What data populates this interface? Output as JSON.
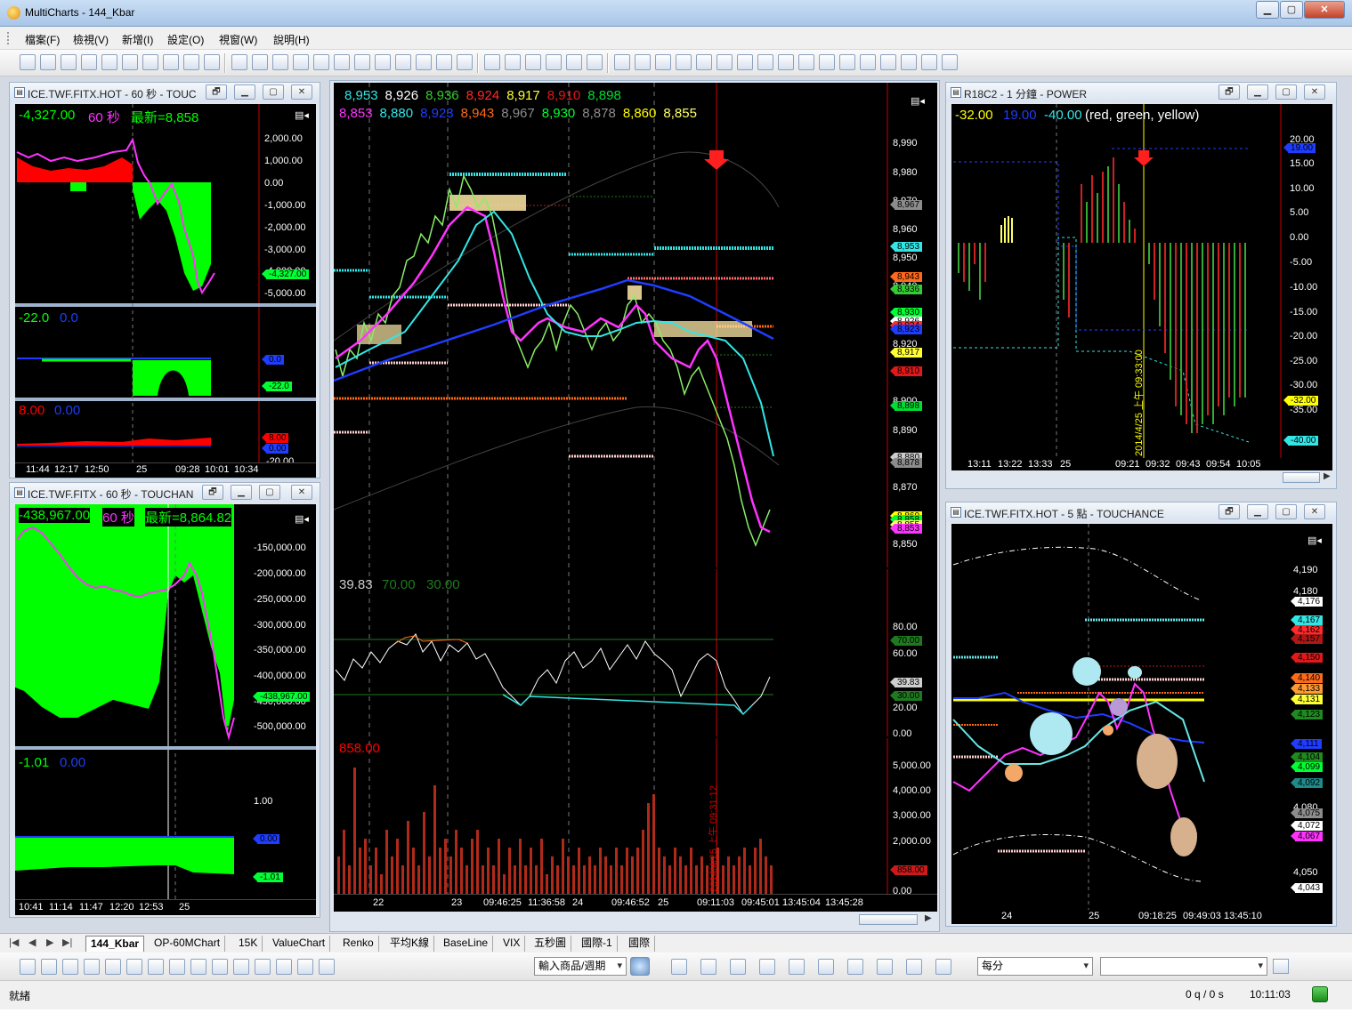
{
  "window": {
    "title": "MultiCharts - 144_Kbar"
  },
  "menu": [
    "檔案(F)",
    "檢視(V)",
    "新增(I)",
    "設定(O)",
    "視窗(W)",
    "說明(H)"
  ],
  "panes": {
    "left_top": {
      "title": "ICE.TWF.FITX.HOT - 60 秒 - TOUC",
      "status1": "-4,327.00",
      "status2": "60 秒",
      "status3": "最新=8,858",
      "yaxis": [
        "2,000.00",
        "1,000.00",
        "0.00",
        "-1,000.00",
        "-2,000.00",
        "-3,000.00",
        "-4,000.00",
        "-5,000.00"
      ],
      "tag_main": "-4,327.00",
      "sub1_status": [
        "-22.0",
        "0.0"
      ],
      "sub1_tags": [
        "0.0",
        "-22.0"
      ],
      "sub2_status": [
        "8.00",
        "0.00"
      ],
      "sub2_tags": [
        "8.00",
        "0.00"
      ],
      "sub2_axis_cut": "-20.00",
      "xaxis": [
        "11:44",
        "12:17",
        "12:50",
        "25",
        "09:28",
        "10:01",
        "10:34"
      ]
    },
    "left_bottom": {
      "title": "ICE.TWF.FITX - 60 秒 - TOUCHAN",
      "status1": "-438,967.00",
      "status2": "60 秒",
      "status3": "最新=8,864.82",
      "yaxis": [
        "-150,000.00",
        "-200,000.00",
        "-250,000.00",
        "-300,000.00",
        "-350,000.00",
        "-400,000.00",
        "-450,000.00",
        "-500,000.00"
      ],
      "tag_main": "-438,967.00",
      "sub_status": [
        "-1.01",
        "0.00"
      ],
      "sub_axis": "1.00",
      "sub_tags": [
        "0.00",
        "-1.01"
      ],
      "xaxis": [
        "10:41",
        "11:14",
        "11:47",
        "12:20",
        "12:53",
        "25"
      ]
    },
    "center": {
      "row1": [
        "8,953",
        "8,926",
        "8,936",
        "8,924",
        "8,917",
        "8,910",
        "8,898"
      ],
      "row2": [
        "8,853",
        "8,880",
        "8,923",
        "8,943",
        "8,967",
        "8,930",
        "8,878",
        "8,860",
        "8,855"
      ],
      "yaxis": [
        "8,990",
        "8,980",
        "8,970",
        "8,960",
        "8,950",
        "8,940",
        "8,920",
        "8,900",
        "8,890",
        "8,870",
        "8,850"
      ],
      "tags": [
        {
          "v": "8,967",
          "c": "#8c8c8c"
        },
        {
          "v": "8,953",
          "c": "#33e6e6"
        },
        {
          "v": "8,943",
          "c": "#ff6a1a"
        },
        {
          "v": "8,936",
          "c": "#33cc33"
        },
        {
          "v": "8,930",
          "c": "#00ff33"
        },
        {
          "v": "8,926",
          "c": "#ffffff"
        },
        {
          "v": "8,924",
          "c": "#ff2a2a"
        },
        {
          "v": "8,923",
          "c": "#1f3dff"
        },
        {
          "v": "8,917",
          "c": "#ffff33"
        },
        {
          "v": "8,910",
          "c": "#e31818"
        },
        {
          "v": "8,898",
          "c": "#00dd33"
        },
        {
          "v": "8,880",
          "c": "#cccccc"
        },
        {
          "v": "8,878",
          "c": "#8c8c8c"
        },
        {
          "v": "8,860",
          "c": "#ffff00"
        },
        {
          "v": "8,858",
          "c": "#00ff33"
        },
        {
          "v": "8,855",
          "c": "#ffff66"
        },
        {
          "v": "8,853",
          "c": "#ff33ff"
        }
      ],
      "ind_status": [
        "39.83",
        "70.00",
        "30.00"
      ],
      "ind_axis": [
        "80.00",
        "60.00",
        "20.00",
        "0.00"
      ],
      "ind_tags": [
        {
          "v": "70.00",
          "c": "#1f7a1f"
        },
        {
          "v": "39.83",
          "c": "#cfcfcf"
        },
        {
          "v": "30.00",
          "c": "#1f7a1f"
        }
      ],
      "vol_status": "858.00",
      "vol_axis": [
        "5,000.00",
        "4,000.00",
        "3,000.00",
        "2,000.00",
        "0.00"
      ],
      "vol_tag": "858.00",
      "vline_label": "2014/4/25 上午 09:31:12",
      "xaxis": [
        "22",
        "23",
        "09:46:25",
        "11:36:58",
        "24",
        "09:46:52",
        "25",
        "09:11:03",
        "09:45:01",
        "13:45:04",
        "13:45:28"
      ]
    },
    "right_top": {
      "title": "R18C2 - 1 分鐘 - POWER",
      "status": [
        "-32.00",
        "19.00",
        "-40.00",
        "(red,  green,  yellow)"
      ],
      "yaxis": [
        "20.00",
        "15.00",
        "10.00",
        "5.00",
        "0.00",
        "-5.00",
        "-10.00",
        "-15.00",
        "-20.00",
        "-25.00",
        "-30.00",
        "-35.00"
      ],
      "tags": [
        {
          "v": "19.00",
          "c": "#1f3dff"
        },
        {
          "v": "-32.00",
          "c": "#ffff00"
        },
        {
          "v": "-40.00",
          "c": "#33e6e6"
        }
      ],
      "vline_label": "2014/4/25 上午 09:33:00",
      "xaxis": [
        "13:11",
        "13:22",
        "13:33",
        "25",
        "09:21",
        "09:32",
        "09:43",
        "09:54",
        "10:05"
      ]
    },
    "right_bottom": {
      "title": "ICE.TWF.FITX.HOT - 5 點 - TOUCHANCE",
      "yaxis": [
        "4,190",
        "4,180",
        "4,080",
        "4,050"
      ],
      "tags": [
        {
          "v": "4,176",
          "c": "#ffffff"
        },
        {
          "v": "4,167",
          "c": "#33e6e6"
        },
        {
          "v": "4,162",
          "c": "#ff2a2a"
        },
        {
          "v": "4,157",
          "c": "#b01818"
        },
        {
          "v": "4,150",
          "c": "#e31818"
        },
        {
          "v": "4,140",
          "c": "#ff6a1a"
        },
        {
          "v": "4,133",
          "c": "#ff9933"
        },
        {
          "v": "4,131",
          "c": "#ffff33"
        },
        {
          "v": "4,123",
          "c": "#1f8a1f"
        },
        {
          "v": "4,111",
          "c": "#1f3dff"
        },
        {
          "v": "4,104",
          "c": "#1f8a1f"
        },
        {
          "v": "4,099",
          "c": "#00ff33"
        },
        {
          "v": "4,092",
          "c": "#1f8a8a"
        },
        {
          "v": "4,075",
          "c": "#8c8c8c"
        },
        {
          "v": "4,072",
          "c": "#ffffff"
        },
        {
          "v": "4,067",
          "c": "#ff33ff"
        },
        {
          "v": "4,043",
          "c": "#ffffff"
        }
      ],
      "xaxis": [
        "24",
        "25",
        "09:18:25",
        "09:49:03",
        "13:45:10"
      ]
    }
  },
  "tabs": [
    "144_Kbar",
    "OP-60MChart",
    "15K",
    "ValueChart",
    "Renko",
    "平均K線",
    "BaseLine",
    "VIX",
    "五秒圖",
    "國際-1",
    "國際"
  ],
  "drawbar": {
    "symbol_input": "輸入商品/週期",
    "period": "每分"
  },
  "status": {
    "left": "就緒",
    "queue": "0 q / 0 s",
    "time": "10:11:03"
  },
  "colors": {
    "panel": "#000000",
    "ma_cyan": "#33e6e6",
    "ma_magenta": "#ff33ff",
    "ma_blue": "#1f3dff",
    "up_green": "#00ff00",
    "down_red": "#ff0000"
  }
}
